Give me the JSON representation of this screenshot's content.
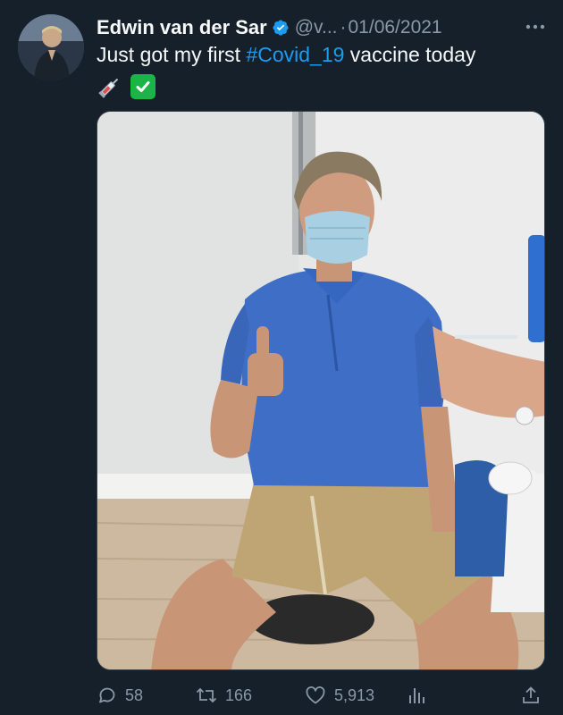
{
  "tweet": {
    "author": {
      "display_name": "Edwin van der Sar",
      "handle": "@v...",
      "verified": true,
      "avatar_icon": "avatar-photo"
    },
    "date": "01/06/2021",
    "separator": "·",
    "text_before": "Just got my first ",
    "hashtag": "#Covid_19",
    "text_after": " vaccine today",
    "emojis": [
      "syringe-emoji",
      "check-mark-button-emoji"
    ],
    "media": {
      "type": "photo",
      "icon": "photo-vaccination"
    },
    "actions": {
      "replies": "58",
      "retweets": "166",
      "likes": "5,913"
    }
  },
  "colors": {
    "background": "#15202b",
    "text": "#f7f9f9",
    "muted": "#8b98a5",
    "accent": "#1d9bf0",
    "check_green": "#1bb547"
  }
}
